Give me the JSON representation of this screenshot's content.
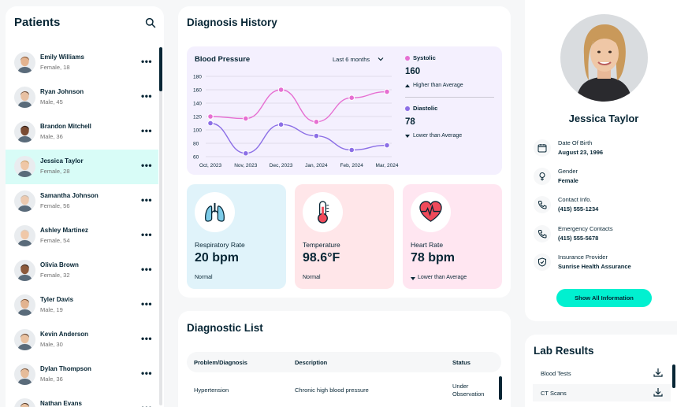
{
  "patients": {
    "title": "Patients",
    "items": [
      {
        "name": "Emily Williams",
        "meta": "Female, 18",
        "skin": "#e3b38f",
        "hair": "#7a4b2a"
      },
      {
        "name": "Ryan Johnson",
        "meta": "Male, 45",
        "skin": "#e7c0a2",
        "hair": "#5b3d2a"
      },
      {
        "name": "Brandon Mitchell",
        "meta": "Male, 36",
        "skin": "#7a4b32",
        "hair": "#1e1410"
      },
      {
        "name": "Jessica Taylor",
        "meta": "Female, 28",
        "skin": "#efc7a6",
        "hair": "#c49a5c"
      },
      {
        "name": "Samantha Johnson",
        "meta": "Female, 56",
        "skin": "#eccab0",
        "hair": "#bfb8b0"
      },
      {
        "name": "Ashley Martinez",
        "meta": "Female, 54",
        "skin": "#f0c8a8",
        "hair": "#d5d0ca"
      },
      {
        "name": "Olivia Brown",
        "meta": "Female, 32",
        "skin": "#8c5a3c",
        "hair": "#2b1c14"
      },
      {
        "name": "Tyler Davis",
        "meta": "Male, 19",
        "skin": "#e2b390",
        "hair": "#6a4428"
      },
      {
        "name": "Kevin Anderson",
        "meta": "Male, 30",
        "skin": "#e9c1a0",
        "hair": "#4a3222"
      },
      {
        "name": "Dylan Thompson",
        "meta": "Male, 36",
        "skin": "#e6bc9a",
        "hair": "#6b4a33"
      },
      {
        "name": "Nathan Evans",
        "meta": "",
        "skin": "#e8c09e",
        "hair": "#3e2a1e"
      }
    ],
    "active_index": 3
  },
  "diagnosis": {
    "title": "Diagnosis History",
    "bp_title": "Blood Pressure",
    "range": "Last 6 months",
    "systolic": {
      "label": "Systolic",
      "value": "160",
      "note": "Higher than Average",
      "color": "#e66fd2"
    },
    "diastolic": {
      "label": "Diastolic",
      "value": "78",
      "note": "Lower than Average",
      "color": "#8c6fe6"
    }
  },
  "chart_data": {
    "type": "line",
    "title": "Blood Pressure",
    "categories": [
      "Oct, 2023",
      "Nov, 2023",
      "Dec, 2023",
      "Jan, 2024",
      "Feb, 2024",
      "Mar, 2024"
    ],
    "series": [
      {
        "name": "Systolic",
        "values": [
          120,
          117,
          160,
          112,
          148,
          157
        ],
        "color": "#e66fd2"
      },
      {
        "name": "Diastolic",
        "values": [
          110,
          65,
          108,
          91,
          70,
          77
        ],
        "color": "#8c6fe6"
      }
    ],
    "yticks": [
      60,
      80,
      100,
      120,
      140,
      160,
      180
    ],
    "ylim": [
      60,
      180
    ],
    "grid": true
  },
  "vitals": [
    {
      "label": "Respiratory Rate",
      "value": "20 bpm",
      "status": "Normal",
      "bg": "#e0f3fa",
      "icon": "lungs-icon"
    },
    {
      "label": "Temperature",
      "value": "98.6°F",
      "status": "Normal",
      "bg": "#ffe6e9",
      "icon": "thermometer-icon"
    },
    {
      "label": "Heart Rate",
      "value": "78 bpm",
      "status": "Lower than Average",
      "bg": "#ffe6f1",
      "icon": "heart-icon"
    }
  ],
  "diagnostic_list": {
    "title": "Diagnostic List",
    "headers": [
      "Problem/Diagnosis",
      "Description",
      "Status"
    ],
    "rows": [
      {
        "problem": "Hypertension",
        "description": "Chronic high blood pressure",
        "status": "Under Observation"
      }
    ]
  },
  "profile": {
    "name": "Jessica Taylor",
    "info": [
      {
        "label": "Date Of Birth",
        "value": "August 23, 1996",
        "icon": "calendar-icon"
      },
      {
        "label": "Gender",
        "value": "Female",
        "icon": "female-icon"
      },
      {
        "label": "Contact Info.",
        "value": "(415) 555-1234",
        "icon": "phone-icon"
      },
      {
        "label": "Emergency Contacts",
        "value": "(415) 555-5678",
        "icon": "phone-icon"
      },
      {
        "label": "Insurance Provider",
        "value": "Sunrise Health Assurance",
        "icon": "shield-icon"
      }
    ],
    "show_all": "Show All Information"
  },
  "lab_results": {
    "title": "Lab Results",
    "items": [
      "Blood Tests",
      "CT Scans"
    ]
  }
}
